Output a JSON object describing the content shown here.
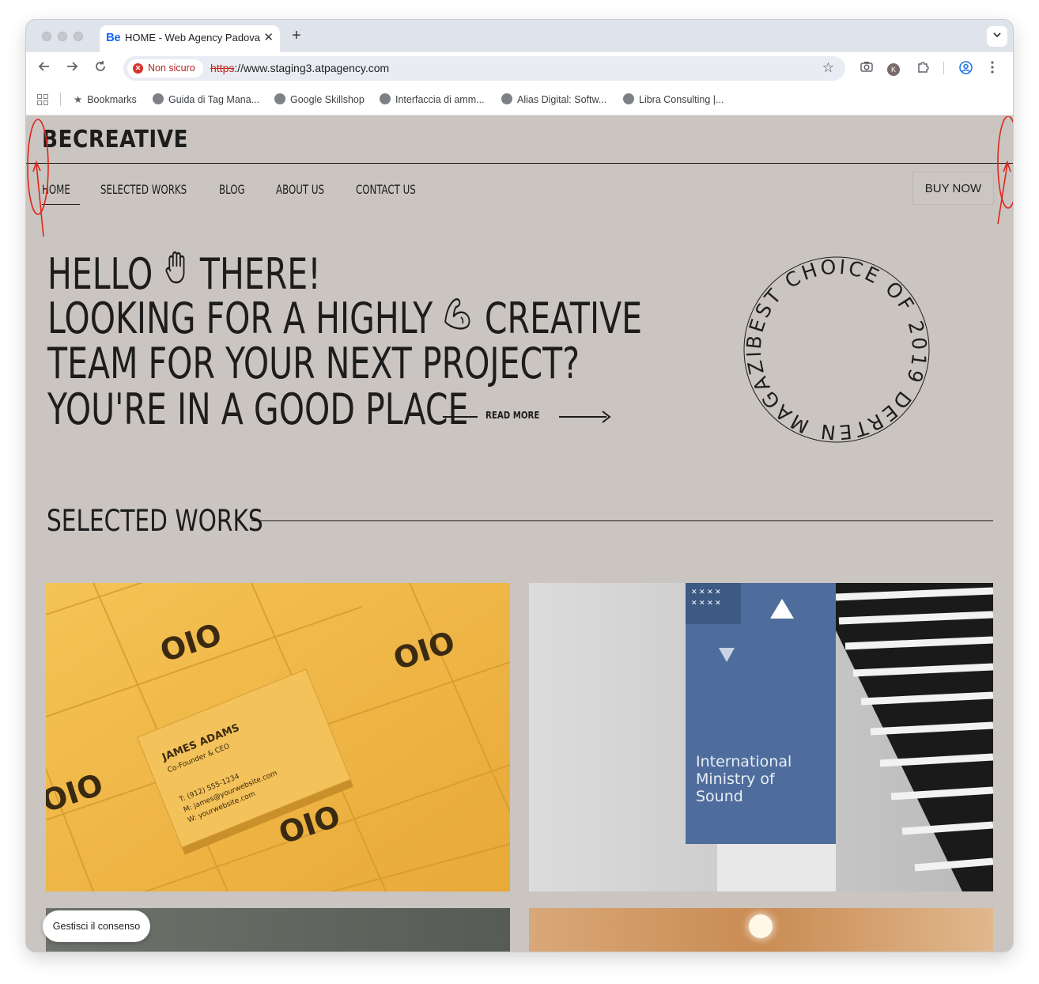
{
  "browser": {
    "tab_favicon": "Be",
    "tab_title": "HOME - Web Agency Padova",
    "tab_close": "✕",
    "new_tab": "+",
    "security_chip": "Non sicuro",
    "url_scheme": "https",
    "url_rest": "://www.staging3.atpagency.com",
    "bookmarks": [
      "Bookmarks",
      "Guida di Tag Mana...",
      "Google Skillshop",
      "Interfaccia di amm...",
      "Alias Digital: Softw...",
      "Libra Consulting |..."
    ],
    "profile_initial": "K"
  },
  "site": {
    "logo": "BECREATIVE",
    "menu": [
      "HOME",
      "SELECTED WORKS",
      "BLOG",
      "ABOUT US",
      "CONTACT US"
    ],
    "buy_now": "BUY NOW",
    "hero_lines": [
      "HELLO",
      "THERE!",
      "LOOKING FOR A HIGHLY",
      "CREATIVE",
      "TEAM FOR YOUR NEXT PROJECT?",
      "YOU'RE IN A GOOD PLACE"
    ],
    "read_more": "READ MORE",
    "badge_text": "BEST CHOICE OF 2019 DERTEN MAGAZINE",
    "section_title": "SELECTED WORKS",
    "works": [
      {
        "card_name": "JAMES ADAMS",
        "card_role": "Co-Founder & CEO",
        "card_phone": "T:  (912) 555-1234",
        "card_mail": "M:  james@yourwebsite.com",
        "card_web": "W:  yourwebsite.com",
        "card_logo": "OIO"
      },
      {
        "banner_text_1": "International",
        "banner_text_2": "Ministry of",
        "banner_text_3": "Sound"
      }
    ],
    "cookie_button": "Gestisci il consenso"
  },
  "colors": {
    "page_bg": "#cac5c0",
    "ink": "#1d1d1d",
    "card_yellow": "#f2b84b",
    "banner_blue": "#4f6d9c",
    "annotation_red": "#e0261b"
  }
}
